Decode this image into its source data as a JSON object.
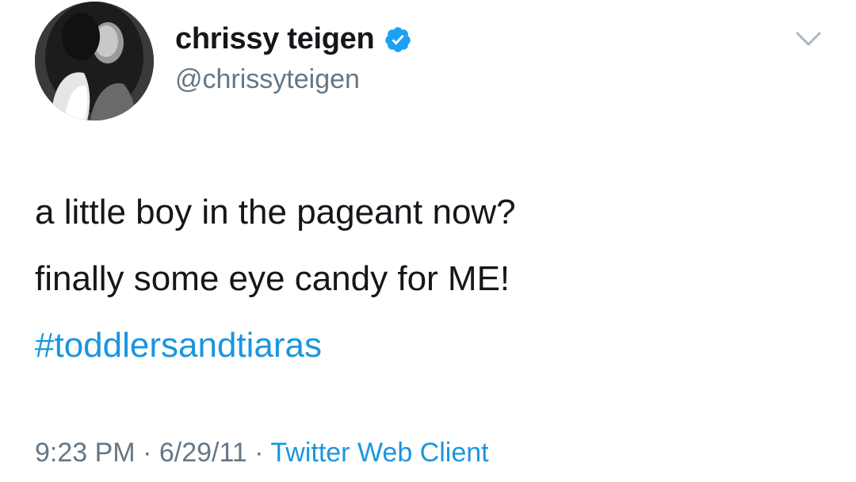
{
  "tweet": {
    "author": {
      "display_name": "chrissy teigen",
      "handle": "@chrissyteigen",
      "verified": true,
      "avatar_icon": "profile-photo"
    },
    "body": {
      "line1": "a little boy in the pageant now?",
      "line2": "finally some eye candy for ME!",
      "hashtag": "#toddlersandtiaras"
    },
    "meta": {
      "time": "9:23 PM",
      "separator1": " · ",
      "date": "6/29/11",
      "separator2": " · ",
      "source": "Twitter Web Client"
    },
    "menu_icon": "chevron-down-icon"
  },
  "colors": {
    "text": "#14171a",
    "secondary": "#657786",
    "link": "#1b95e0",
    "verified": "#1da1f2"
  }
}
